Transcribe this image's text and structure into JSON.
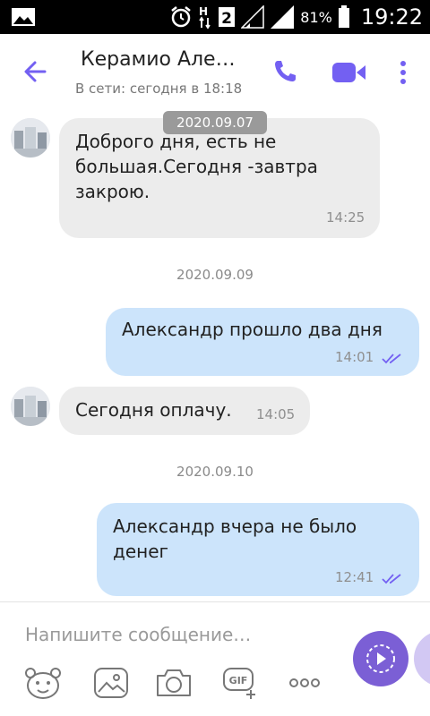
{
  "status_bar": {
    "battery_percent": "81%",
    "time": "19:22",
    "sim_label": "2",
    "network_letter": "H",
    "icons": [
      "gallery-icon",
      "alarm-icon",
      "network-h-icon",
      "sim-2-icon",
      "signal-icon",
      "signal-icon",
      "battery-icon"
    ]
  },
  "header": {
    "contact_name": "Керамио Але…",
    "status": "В сети: сегодня в 18:18",
    "accent_color": "#7360f2"
  },
  "chat": {
    "date_pill": "2020.09.07",
    "messages": [
      {
        "direction": "in",
        "lines": [
          "Доброго дня, есть не",
          "большая.Сегодня -завтра",
          "закрою."
        ],
        "time": "14:25"
      },
      {
        "type": "date",
        "label": "2020.09.09"
      },
      {
        "direction": "out",
        "lines": [
          "Александр прошло два дня"
        ],
        "time": "14:01",
        "status": "read"
      },
      {
        "direction": "in",
        "lines": [
          "Сегодня оплачу."
        ],
        "time": "14:05"
      },
      {
        "type": "date",
        "label": "2020.09.10"
      },
      {
        "direction": "out",
        "lines": [
          "Александр вчера не было",
          "денег"
        ],
        "time": "12:41",
        "status": "read"
      }
    ]
  },
  "composer": {
    "placeholder": "Напишите сообщение…",
    "tools": [
      "sticker-icon",
      "gallery-icon",
      "camera-icon",
      "gif-icon",
      "more-icon"
    ],
    "gif_label": "GIF"
  }
}
